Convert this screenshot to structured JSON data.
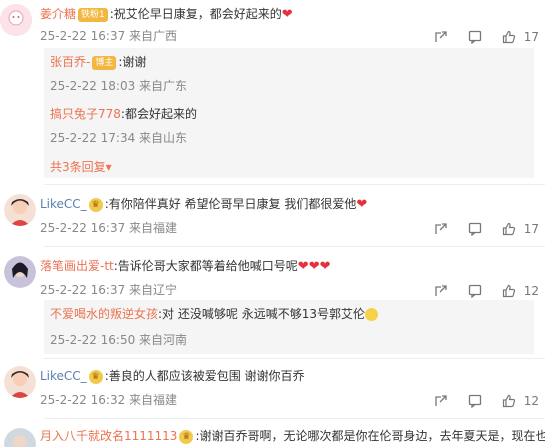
{
  "comments": [
    {
      "user": "姜介糖",
      "badge": "铁粉1",
      "text": ":祝艾伦早日康复，都会好起来的",
      "meta": "25-2-22 16:37 来自广西",
      "likes": "17",
      "replies": [
        {
          "user": "张百乔-",
          "badge": "博主",
          "text": ":谢谢",
          "meta": "25-2-22 18:03 来自广东"
        },
        {
          "user": "搞只兔子778",
          "text": ":都会好起来的",
          "meta": "25-2-22 17:34 来自山东"
        }
      ],
      "more": "共3条回复"
    },
    {
      "user": "LikeCC_",
      "text": ":有你陪伴真好 希望伦哥早日康复 我们都很爱他",
      "meta": "25-2-22 16:37 来自福建",
      "likes": "17"
    },
    {
      "user": "落笔画出爱-tt",
      "text": ":告诉伦哥大家都等着给他喊口号呢",
      "meta": "25-2-22 16:37 来自辽宁",
      "likes": "12",
      "replies": [
        {
          "user": "不爱喝水的叛逆女孩",
          "text": ":对 还没喊够呢 永远喊不够13号郭艾伦",
          "meta": "25-2-22 16:50 来自河南"
        }
      ]
    },
    {
      "user": "LikeCC_",
      "text": ":善良的人都应该被爱包围 谢谢你百乔",
      "meta": "25-2-22 16:32 来自福建",
      "likes": "12"
    },
    {
      "user": "月入八千就改名1111113",
      "text": ":谢谢百乔哥啊，无论哪次都是你在伦哥身边，去年夏天是，现在也"
    }
  ]
}
